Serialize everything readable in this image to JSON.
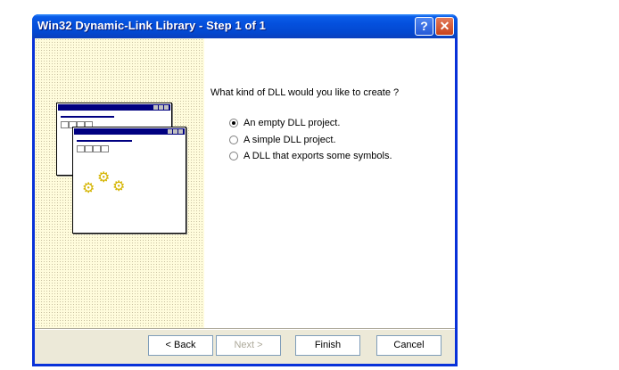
{
  "window": {
    "title": "Win32 Dynamic-Link Library - Step 1 of 1",
    "help_glyph": "?",
    "close_glyph": "✕"
  },
  "wizard": {
    "question": "What kind of DLL would you like to create ?",
    "options": [
      {
        "label": "An empty DLL project.",
        "selected": true
      },
      {
        "label": "A simple DLL project.",
        "selected": false
      },
      {
        "label": "A DLL that exports some symbols.",
        "selected": false
      }
    ]
  },
  "buttons": {
    "back": "< Back",
    "next": "Next >",
    "finish": "Finish",
    "cancel": "Cancel"
  },
  "colors": {
    "title_bar": "#0a5ce8",
    "panel": "#fffcdc",
    "gear": "#d4b400"
  },
  "icons": {
    "gear": "⚙"
  }
}
